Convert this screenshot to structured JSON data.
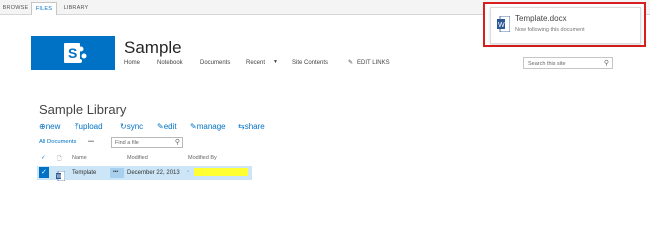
{
  "ribbon": {
    "tabs": [
      {
        "label": "BROWSE"
      },
      {
        "label": "FILES"
      },
      {
        "label": "LIBRARY"
      }
    ]
  },
  "header": {
    "site_title": "Sample",
    "nav": [
      "Home",
      "Notebook",
      "Documents",
      "Recent",
      "Site Contents"
    ],
    "edit_links": "EDIT LINKS",
    "search_placeholder": "Search this site"
  },
  "library": {
    "title": "Sample Library",
    "commands": [
      "new",
      "upload",
      "sync",
      "edit",
      "manage",
      "share"
    ],
    "view_name": "All Documents",
    "view_more": "•••",
    "find_placeholder": "Find a file",
    "columns": {
      "name": "Name",
      "modified": "Modified",
      "modified_by": "Modified By"
    },
    "rows": [
      {
        "name": "Template",
        "ellipsis": "•••",
        "modified": "December 22, 2013"
      }
    ]
  },
  "toast": {
    "file_name": "Template.docx",
    "message": "Now following this document"
  },
  "colors": {
    "accent": "#0072c6",
    "highlight": "#ffff33",
    "toast_border": "#d81e1e"
  }
}
